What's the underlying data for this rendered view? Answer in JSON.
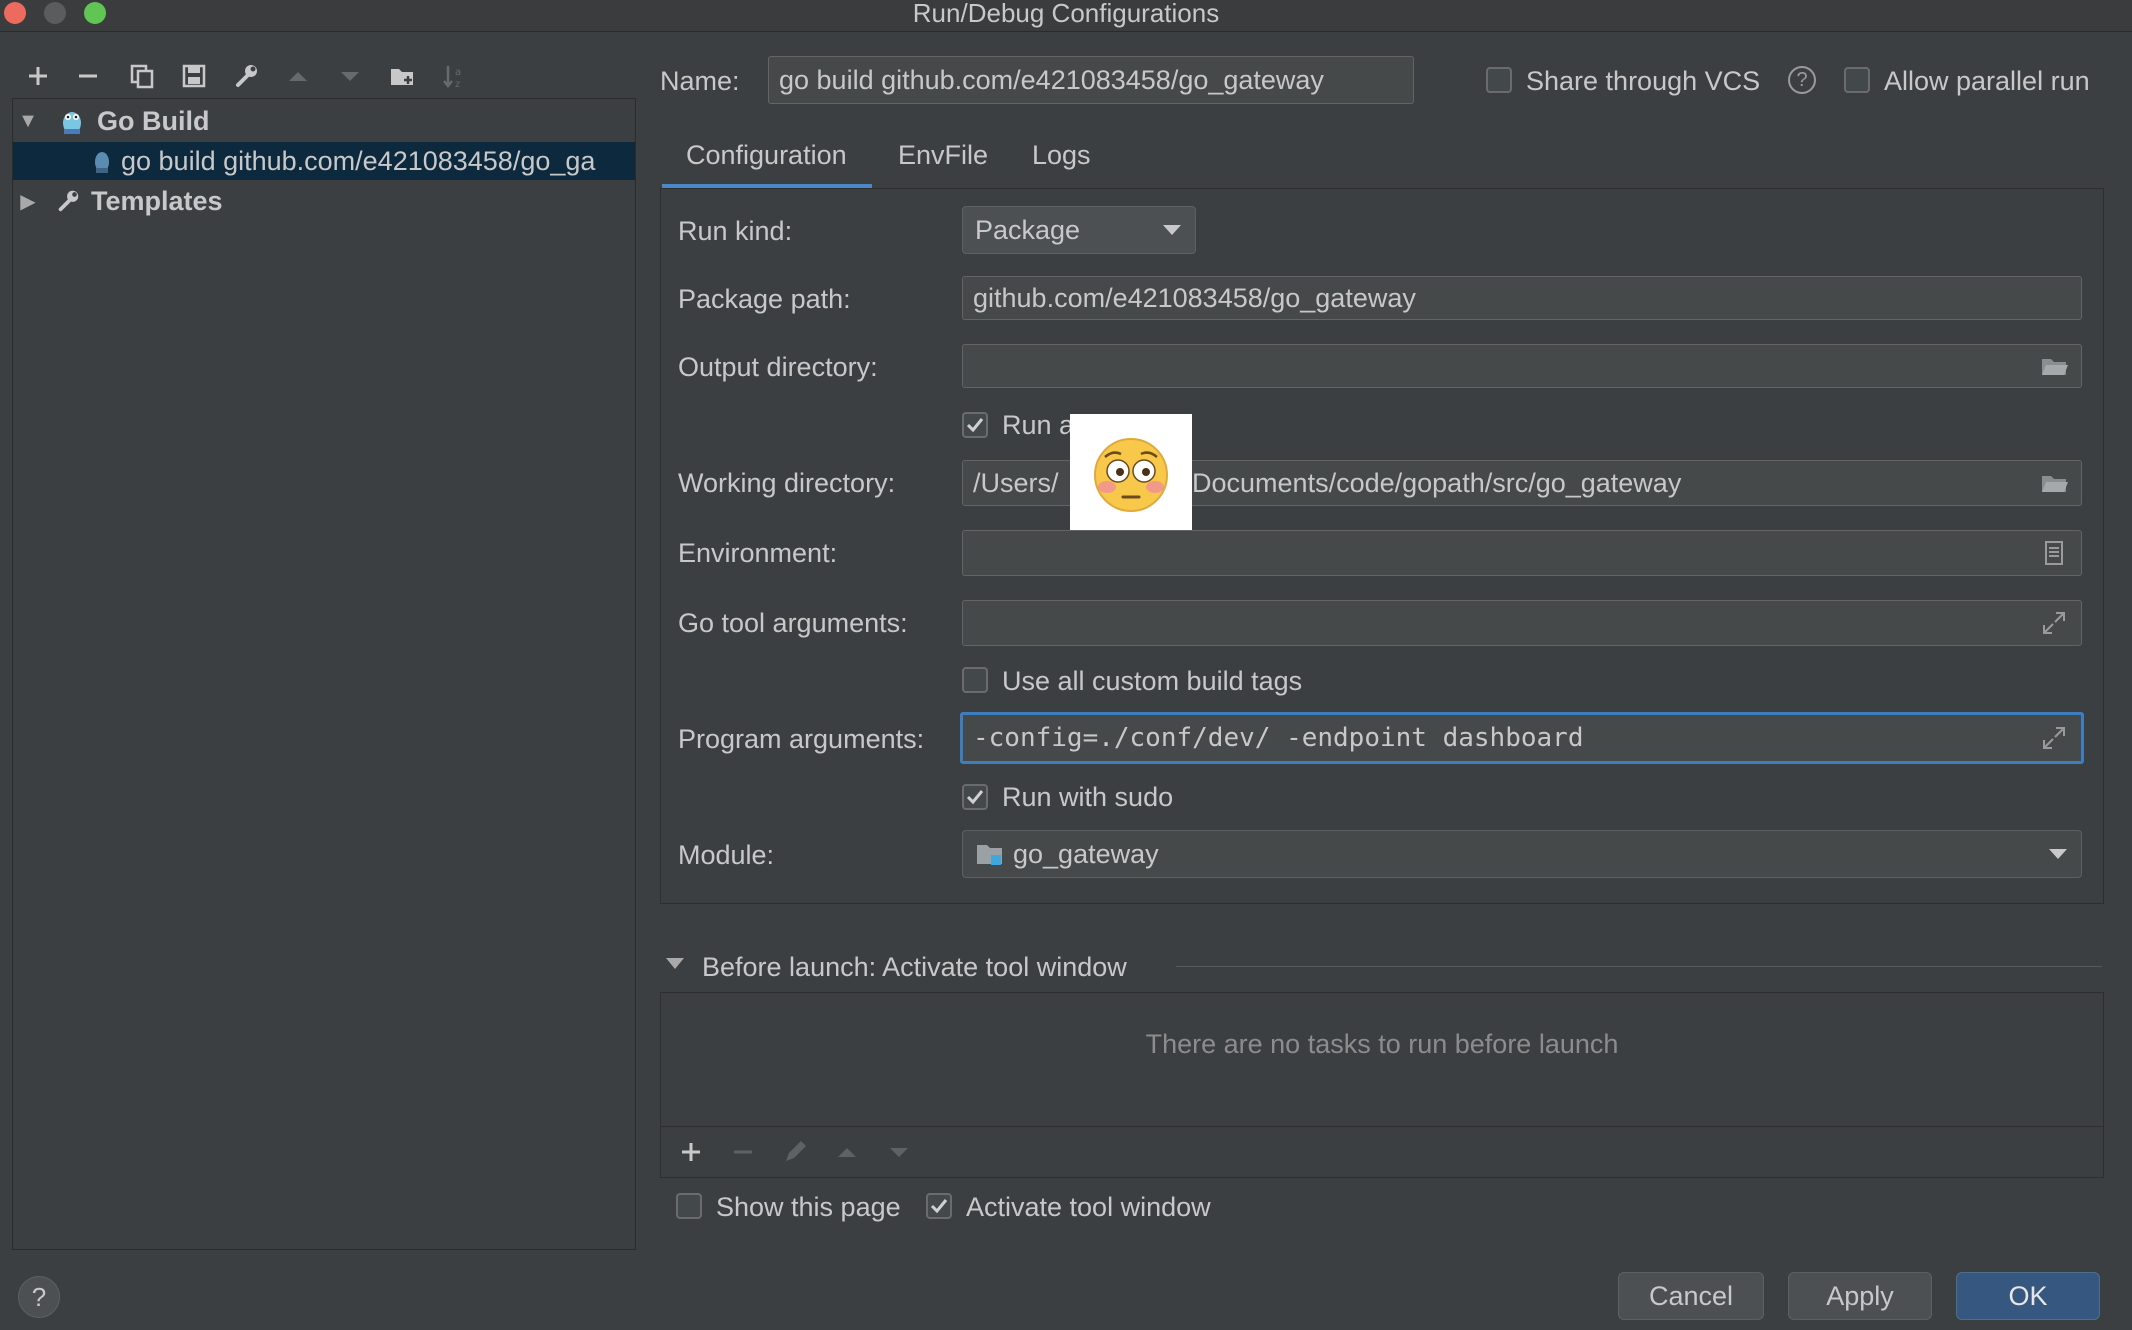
{
  "window": {
    "title": "Run/Debug Configurations"
  },
  "left_toolbar": {
    "icons": [
      "add-icon",
      "remove-icon",
      "copy-icon",
      "save-icon",
      "wrench-icon",
      "move-up-icon",
      "move-down-icon",
      "new-folder-icon",
      "sort-icon"
    ]
  },
  "tree": {
    "group_label": "Go Build",
    "config_item": "go build github.com/e421083458/go_ga",
    "templates_label": "Templates"
  },
  "header": {
    "name_label": "Name:",
    "name_value": "go build github.com/e421083458/go_gateway",
    "share_vcs_label": "Share through VCS",
    "share_vcs_checked": false,
    "allow_parallel_label": "Allow parallel run",
    "allow_parallel_checked": false
  },
  "tabs": [
    {
      "label": "Configuration",
      "active": true
    },
    {
      "label": "EnvFile",
      "active": false
    },
    {
      "label": "Logs",
      "active": false
    }
  ],
  "config": {
    "run_kind_label": "Run kind:",
    "run_kind_value": "Package",
    "package_path_label": "Package path:",
    "package_path_value": "github.com/e421083458/go_gateway",
    "output_dir_label": "Output directory:",
    "output_dir_value": "",
    "run_after_build_label": "Run a",
    "run_after_build_checked": true,
    "working_dir_label": "Working directory:",
    "working_dir_value_prefix": "/Users/",
    "working_dir_value_suffix": "/Documents/code/gopath/src/go_gateway",
    "environment_label": "Environment:",
    "environment_value": "",
    "go_tool_args_label": "Go tool arguments:",
    "go_tool_args_value": "",
    "custom_tags_label": "Use all custom build tags",
    "custom_tags_checked": false,
    "program_args_label": "Program arguments:",
    "program_args_value": "-config=./conf/dev/ -endpoint dashboard",
    "sudo_label": "Run with sudo",
    "sudo_checked": true,
    "module_label": "Module:",
    "module_value": "go_gateway"
  },
  "before_launch": {
    "header": "Before launch: Activate tool window",
    "empty_text": "There are no tasks to run before launch",
    "show_page_label": "Show this page",
    "show_page_checked": false,
    "activate_label": "Activate tool window",
    "activate_checked": true
  },
  "footer": {
    "help_label": "?",
    "cancel_label": "Cancel",
    "apply_label": "Apply",
    "ok_label": "OK"
  },
  "colors": {
    "background": "#3c3f41",
    "selection": "#0d293e",
    "focus_border": "#3d7ec1",
    "primary_button": "#365880"
  }
}
